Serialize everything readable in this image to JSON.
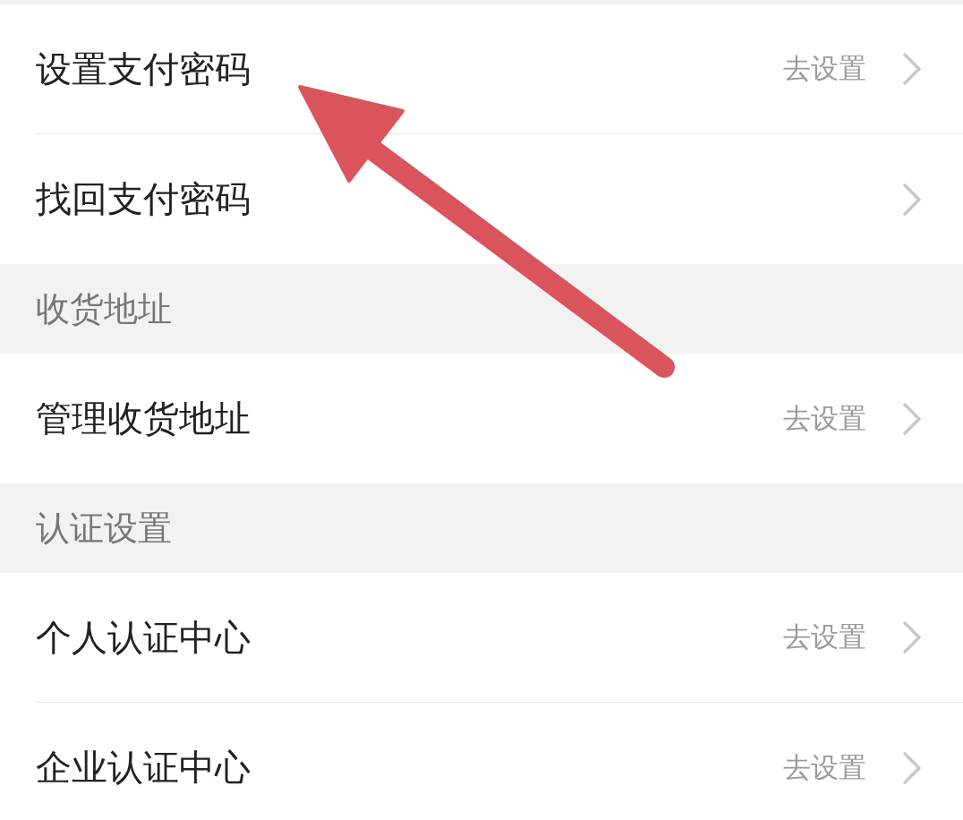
{
  "list": [
    {
      "kind": "row",
      "label": "设置支付密码",
      "action": "去设置"
    },
    {
      "kind": "row",
      "label": "找回支付密码"
    },
    {
      "kind": "header",
      "label": "收货地址"
    },
    {
      "kind": "row",
      "label": "管理收货地址",
      "action": "去设置"
    },
    {
      "kind": "header",
      "label": "认证设置"
    },
    {
      "kind": "row",
      "label": "个人认证中心",
      "action": "去设置"
    },
    {
      "kind": "row",
      "label": "企业认证中心",
      "action": "去设置"
    }
  ]
}
